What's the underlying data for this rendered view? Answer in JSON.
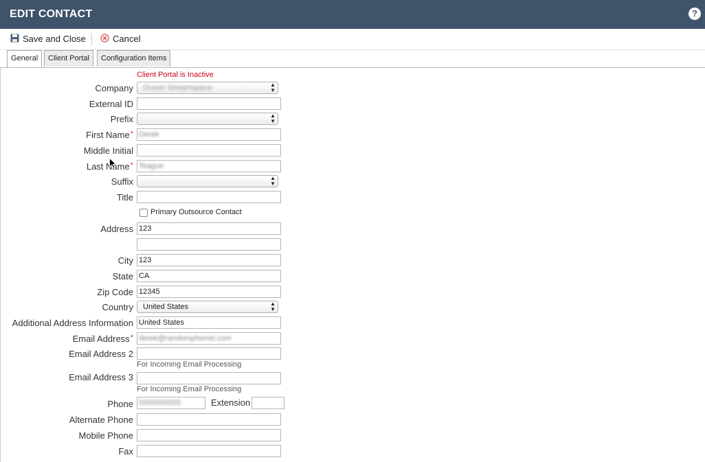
{
  "window": {
    "title": "EDIT CONTACT",
    "help_label": "?"
  },
  "toolbar": {
    "save_label": "Save and Close",
    "cancel_label": "Cancel"
  },
  "tabs": [
    {
      "label": "General",
      "active": true
    },
    {
      "label": "Client Portal",
      "active": false
    },
    {
      "label": "Configuration Items",
      "active": false
    }
  ],
  "form": {
    "notice": "Client Portal is Inactive",
    "company": {
      "label": "Company",
      "value": "Ocean Streamspace"
    },
    "external_id": {
      "label": "External ID",
      "value": ""
    },
    "prefix": {
      "label": "Prefix",
      "value": ""
    },
    "first_name": {
      "label": "First Name",
      "value": "Derek",
      "required": "*"
    },
    "middle_initial": {
      "label": "Middle Initial",
      "value": ""
    },
    "last_name": {
      "label": "Last Name",
      "value": "Teague",
      "required": "*"
    },
    "suffix": {
      "label": "Suffix",
      "value": ""
    },
    "title": {
      "label": "Title",
      "value": ""
    },
    "primary_outsource": {
      "label": "Primary Outsource Contact",
      "checked": false
    },
    "address": {
      "label": "Address",
      "line1": "123",
      "line2": ""
    },
    "city": {
      "label": "City",
      "value": "123"
    },
    "state": {
      "label": "State",
      "value": "CA"
    },
    "zip": {
      "label": "Zip Code",
      "value": "12345"
    },
    "country": {
      "label": "Country",
      "value": "United States"
    },
    "additional_address": {
      "label": "Additional Address Information",
      "value": "United States"
    },
    "email": {
      "label": "Email Address",
      "value": "derek@randompherret.com",
      "required": "*"
    },
    "email2": {
      "label": "Email Address 2",
      "value": "",
      "hint": "For Incoming Email Processing"
    },
    "email3": {
      "label": "Email Address 3",
      "value": "",
      "hint": "For Incoming Email Processing"
    },
    "phone": {
      "label": "Phone",
      "value": "5555555555"
    },
    "extension": {
      "label": "Extension",
      "value": ""
    },
    "alternate_phone": {
      "label": "Alternate Phone",
      "value": ""
    },
    "mobile_phone": {
      "label": "Mobile Phone",
      "value": ""
    },
    "fax": {
      "label": "Fax",
      "value": ""
    }
  },
  "icons": {
    "save": "floppy-disk-icon",
    "cancel": "cancel-circle-icon",
    "select_arrows": "up-down-arrows-icon"
  },
  "colors": {
    "titlebar": "#3f536b",
    "notice": "#d0021b",
    "required": "#c0392b"
  }
}
